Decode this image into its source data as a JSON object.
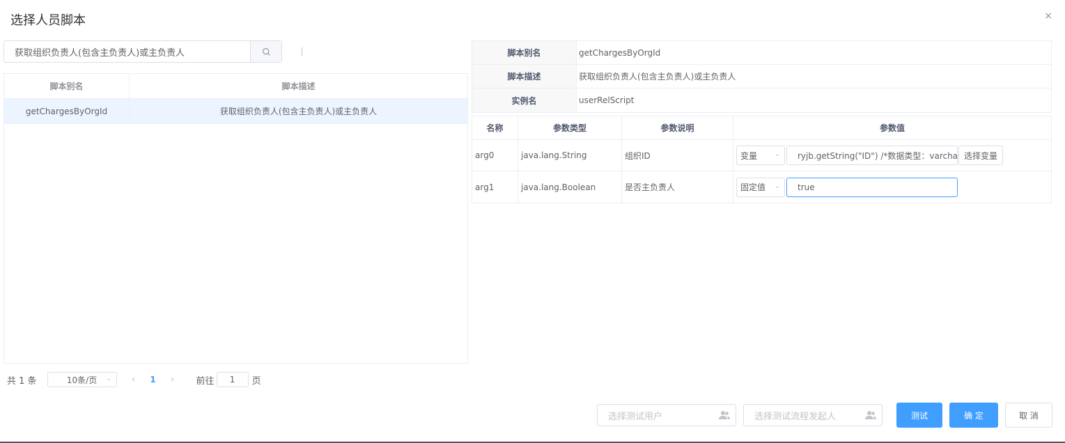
{
  "dialog": {
    "title": "选择人员脚本",
    "close_glyph": "×"
  },
  "search": {
    "value": "获取组织负责人(包含主负责人)或主负责人",
    "icon": "search-icon"
  },
  "script_table": {
    "headers": [
      "脚本别名",
      "脚本描述"
    ],
    "rows": [
      {
        "alias": "getChargesByOrgId",
        "desc": "获取组织负责人(包含主负责人)或主负责人"
      }
    ]
  },
  "pagination": {
    "total": "共 1 条",
    "page_size": "10条/页",
    "prev": "‹",
    "current": "1",
    "next": "›",
    "goto_prefix": "前往",
    "goto_value": "1",
    "goto_suffix": "页"
  },
  "info": [
    {
      "label": "脚本别名",
      "value": "getChargesByOrgId"
    },
    {
      "label": "脚本描述",
      "value": "获取组织负责人(包含主负责人)或主负责人"
    },
    {
      "label": "实例名",
      "value": "userRelScript"
    }
  ],
  "params": {
    "headers": [
      "名称",
      "参数类型",
      "参数说明",
      "参数值"
    ],
    "rows": [
      {
        "name": "arg0",
        "type": "java.lang.String",
        "desc": "组织ID",
        "mode": "变量",
        "value": "ryjb.getString(\"ID\") /*数据类型：varchar*",
        "pick_label": "选择变量"
      },
      {
        "name": "arg1",
        "type": "java.lang.Boolean",
        "desc": "是否主负责人",
        "mode": "固定值",
        "value": "true"
      }
    ]
  },
  "footer": {
    "test_user_placeholder": "选择测试用户",
    "test_starter_placeholder": "选择测试流程发起人",
    "test_label": "测试",
    "confirm_label": "确 定",
    "cancel_label": "取 消",
    "accent": "#409eff"
  }
}
